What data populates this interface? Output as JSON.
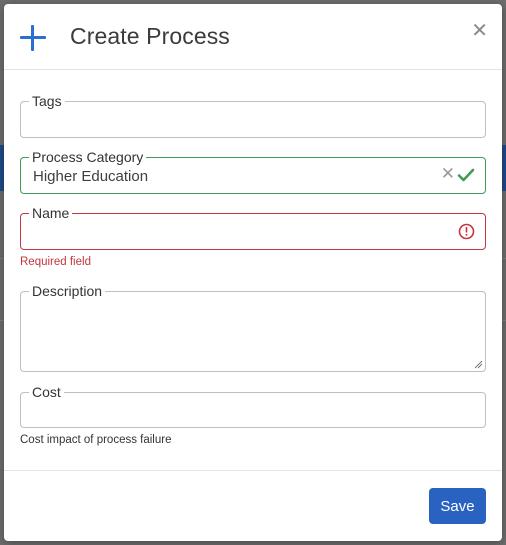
{
  "dialog": {
    "title": "Create Process",
    "icon": "plus-icon",
    "close_icon": "close-icon",
    "accent_color": "#2a6fd1"
  },
  "fields": {
    "tags": {
      "label": "Tags",
      "value": ""
    },
    "process_category": {
      "label": "Process Category",
      "value": "Higher Education",
      "status": "valid",
      "status_color": "#3e9b58"
    },
    "name": {
      "label": "Name",
      "value": "",
      "error": "Required field",
      "error_color": "#c7353c"
    },
    "description": {
      "label": "Description",
      "value": ""
    },
    "cost": {
      "label": "Cost",
      "value": "",
      "helper": "Cost impact of process failure"
    }
  },
  "footer": {
    "save_label": "Save",
    "save_color": "#2a62c2"
  }
}
